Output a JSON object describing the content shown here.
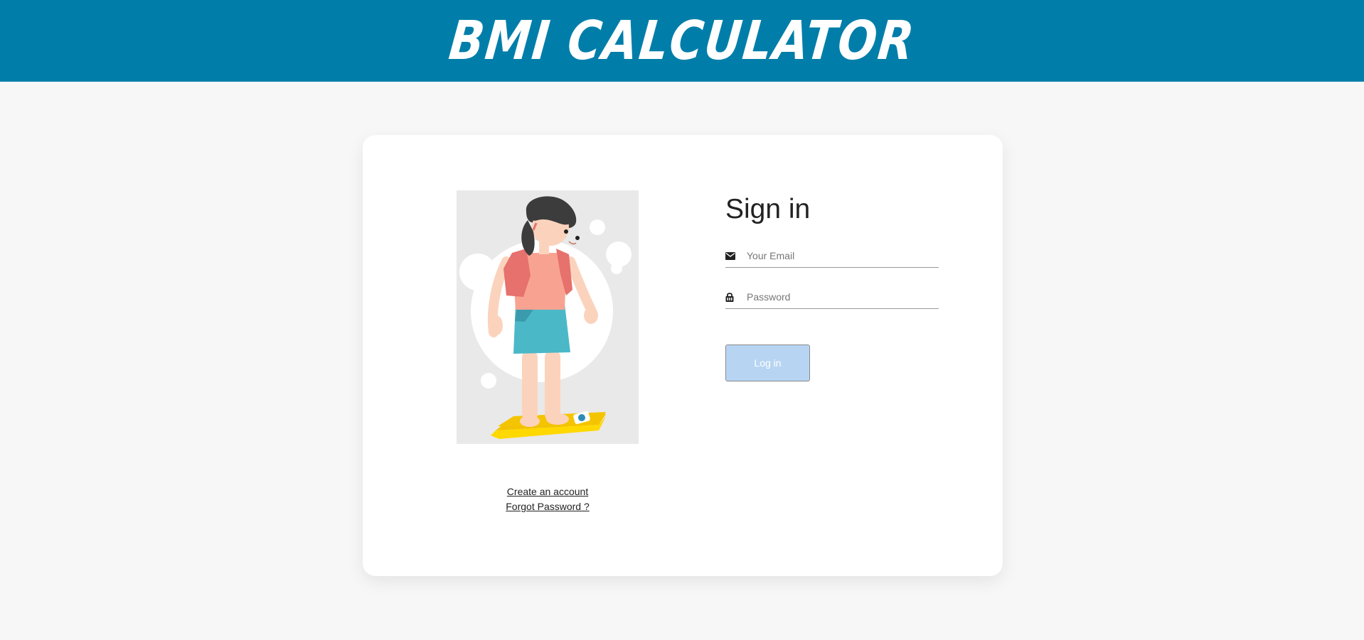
{
  "header": {
    "title": "BMI CALCULATOR",
    "background_color": "#007ea9"
  },
  "illustration": {
    "name": "woman-on-scale-illustration",
    "background_color": "#e9e9e9"
  },
  "links": {
    "create_account": "Create an account",
    "forgot_password": "Forgot Password ?"
  },
  "form": {
    "title": "Sign in",
    "email": {
      "icon": "mail-icon",
      "placeholder": "Your Email",
      "value": ""
    },
    "password": {
      "icon": "lock-icon",
      "placeholder": "Password",
      "value": ""
    },
    "login_button": {
      "label": "Log in",
      "color": "#b7d5f2"
    }
  },
  "colors": {
    "page_background": "#f7f7f7",
    "card_background": "#ffffff"
  }
}
